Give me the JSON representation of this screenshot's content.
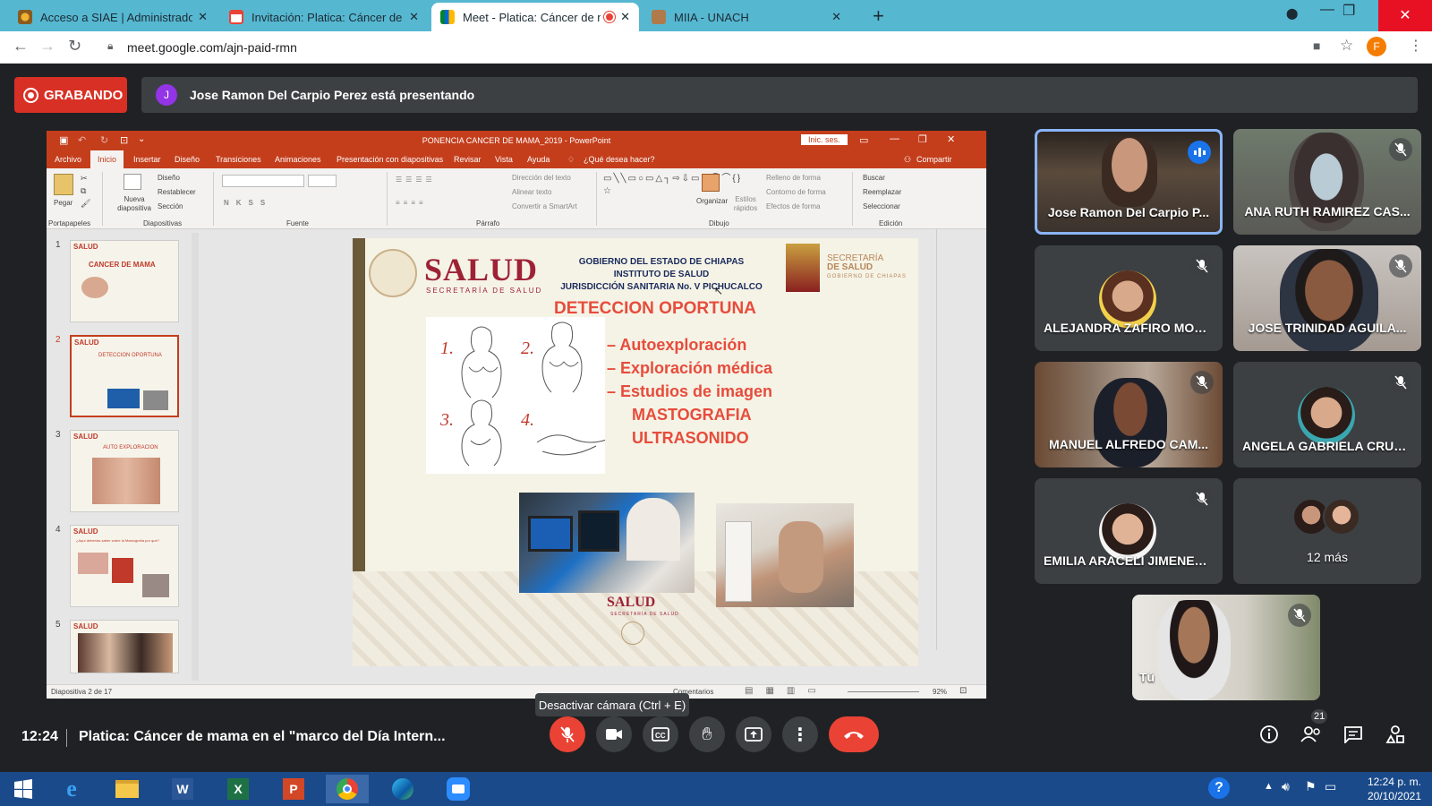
{
  "browser": {
    "tabs": [
      {
        "title": "Acceso a SIAE | Administrador | U",
        "active": false,
        "favicon": "siae-icon"
      },
      {
        "title": "Invitación: Platica: Cáncer de ma",
        "active": false,
        "favicon": "gmail-icon"
      },
      {
        "title": "Meet - Platica: Cáncer de ma",
        "active": true,
        "favicon": "meet-icon"
      },
      {
        "title": "MIIA - UNACH",
        "active": false,
        "favicon": "unach-icon"
      }
    ],
    "url": "meet.google.com/ajn-paid-rmn",
    "profile_initial": "F"
  },
  "meet": {
    "recording_label": "GRABANDO",
    "presenter_initial": "J",
    "presenter_text": "Jose Ramon Del Carpio Perez está presentando",
    "clock": "12:24",
    "meeting_title": "Platica: Cáncer de mama en el \"marco del Día Intern...",
    "tooltip": "Desactivar cámara (Ctrl + E)",
    "participant_count": "21",
    "participants": [
      {
        "name": "Jose Ramon Del Carpio P...",
        "speaking": true,
        "muted": false
      },
      {
        "name": "ANA RUTH RAMIREZ CAS...",
        "speaking": false,
        "muted": true
      },
      {
        "name": "ALEJANDRA ZAFIRO MOR...",
        "speaking": false,
        "muted": true
      },
      {
        "name": "JOSE TRINIDAD AGUILA...",
        "speaking": false,
        "muted": true
      },
      {
        "name": "MANUEL ALFREDO CAM...",
        "speaking": false,
        "muted": true
      },
      {
        "name": "ANGELA GABRIELA CRUZ ...",
        "speaking": false,
        "muted": true
      },
      {
        "name": "EMILIA ARACELI JIMENEZ ...",
        "speaking": false,
        "muted": true
      }
    ],
    "more_label": "12 más",
    "self_label": "Tú"
  },
  "ppt": {
    "title": "PONENCIA CANCER DE MAMA_2019 - PowerPoint",
    "signin": "Inic. ses.",
    "menu": [
      "Archivo",
      "Inicio",
      "Insertar",
      "Diseño",
      "Transiciones",
      "Animaciones",
      "Presentación con diapositivas",
      "Revisar",
      "Vista",
      "Ayuda",
      "¿Qué desea hacer?"
    ],
    "share": "Compartir",
    "ribbon": {
      "paste": "Pegar",
      "new_slide": "Nueva diapositiva",
      "layout": "Diseño",
      "reset": "Restablecer",
      "section": "Sección",
      "text_direction": "Dirección del texto",
      "align_text": "Alinear texto",
      "smartart": "Convertir a SmartArt",
      "arrange": "Organizar",
      "quick_styles": "Estilos rápidos",
      "shape_fill": "Relleno de forma",
      "shape_outline": "Contorno de forma",
      "shape_effects": "Efectos de forma",
      "find": "Buscar",
      "replace": "Reemplazar",
      "select": "Seleccionar",
      "groups": [
        "Portapapeles",
        "Diapositivas",
        "Fuente",
        "Párrafo",
        "Dibujo",
        "Edición"
      ]
    },
    "thumbnails": [
      {
        "num": "1",
        "title": "CANCER DE MAMA"
      },
      {
        "num": "2",
        "title": "DETECCION OPORTUNA"
      },
      {
        "num": "3",
        "title": "AUTO EXPLORACION"
      },
      {
        "num": "4",
        "title": "¿Aquí deberías saber sobre la Mastografía por qué?"
      },
      {
        "num": "5",
        "title": ""
      }
    ],
    "status_left": "Diapositiva 2 de 17",
    "comments": "Comentarios",
    "zoom": "92%",
    "slide": {
      "brand": "SALUD",
      "brand_sub": "SECRETARÍA DE SALUD",
      "gov": [
        "GOBIERNO DEL ESTADO DE CHIAPAS",
        "INSTITUTO DE SALUD",
        "JURISDICCIÓN SANITARIA No. V PICHUCALCO"
      ],
      "sec_logo": [
        "SECRETARÍA",
        "DE SALUD",
        "GOBIERNO DE CHIAPAS"
      ],
      "heading": "DETECCION OPORTUNA",
      "bullets": [
        "– Autoexploración",
        "– Exploración médica",
        "– Estudios de imagen"
      ],
      "sub_items": [
        "MASTOGRAFIA",
        "ULTRASONIDO"
      ],
      "step_numbers": [
        "1.",
        "2.",
        "3.",
        "4."
      ],
      "footer_brand": "SALUD",
      "footer_sub": "SECRETARÍA DE SALUD"
    }
  },
  "taskbar": {
    "time": "12:24 p. m.",
    "date": "20/10/2021",
    "apps": [
      "windows-start-icon",
      "internet-explorer-icon",
      "file-explorer-icon",
      "word-icon",
      "excel-icon",
      "powerpoint-icon",
      "chrome-icon",
      "edge-icon",
      "zoom-icon"
    ]
  }
}
